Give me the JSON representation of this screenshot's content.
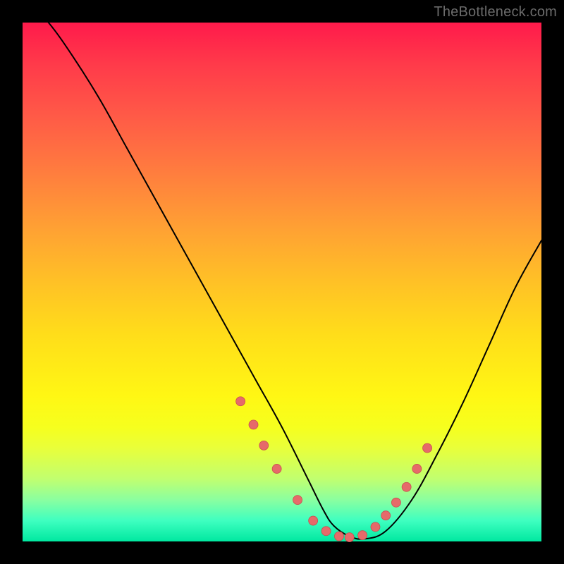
{
  "attribution": "TheBottleneck.com",
  "colors": {
    "page_bg": "#000000",
    "curve": "#000000",
    "dot_fill": "#e66a6a",
    "dot_stroke": "#c94f4f",
    "gradient_top": "#ff1a4b",
    "gradient_upper_mid": "#ffa233",
    "gradient_mid": "#ffdd1a",
    "gradient_lower": "#c0ff70",
    "gradient_bottom": "#00e8a0"
  },
  "chart_data": {
    "type": "line",
    "title": "",
    "xlabel": "",
    "ylabel": "",
    "xlim": [
      0,
      100
    ],
    "ylim": [
      0,
      100
    ],
    "grid": false,
    "series": [
      {
        "name": "profile-curve",
        "x": [
          0,
          5,
          10,
          15,
          20,
          25,
          30,
          35,
          40,
          45,
          50,
          55,
          58,
          60,
          63,
          66,
          70,
          75,
          80,
          85,
          90,
          95,
          100
        ],
        "values": [
          105,
          100,
          93,
          85,
          76,
          67,
          58,
          49,
          40,
          31,
          22,
          12,
          6,
          3,
          1,
          0.5,
          2,
          8,
          17,
          27,
          38,
          49,
          58
        ]
      }
    ],
    "dots": {
      "name": "markers",
      "x": [
        42.0,
        44.5,
        46.5,
        49.0,
        53.0,
        56.0,
        58.5,
        61.0,
        63.0,
        65.5,
        68.0,
        70.0,
        72.0,
        74.0,
        76.0,
        78.0
      ],
      "values": [
        27.0,
        22.5,
        18.5,
        14.0,
        8.0,
        4.0,
        2.0,
        1.0,
        0.8,
        1.2,
        2.8,
        5.0,
        7.5,
        10.5,
        14.0,
        18.0
      ]
    }
  }
}
